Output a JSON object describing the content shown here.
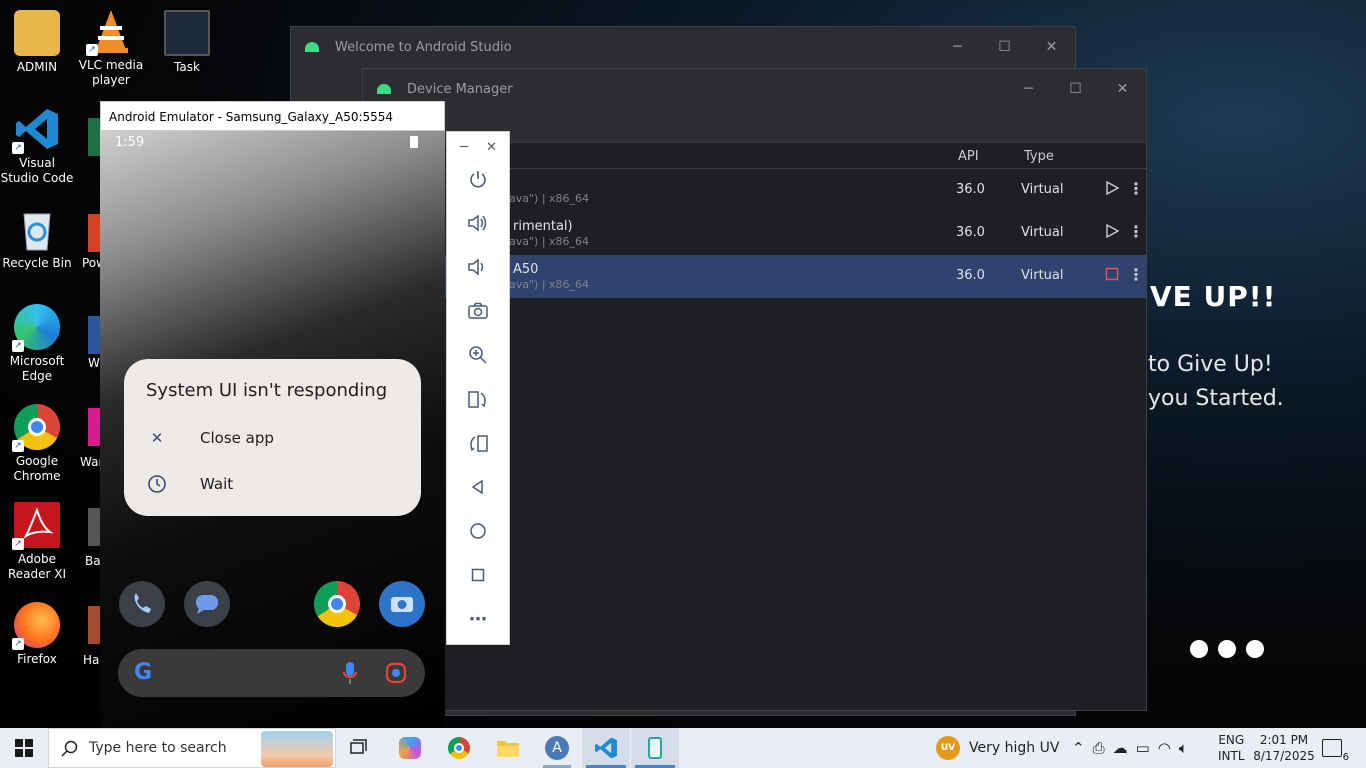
{
  "desktop": {
    "icons": [
      {
        "label": "ADMIN"
      },
      {
        "label": "VLC media player"
      },
      {
        "label": "Task"
      },
      {
        "label": "Visual Studio Code"
      },
      {
        "label": "Recycle Bin"
      },
      {
        "label": "Microsoft Edge"
      },
      {
        "label": "Google Chrome"
      },
      {
        "label": "Adobe Reader XI"
      },
      {
        "label": "Firefox"
      }
    ],
    "partial_labels": [
      "Pow",
      "W",
      "War",
      "Ba",
      "Ha"
    ],
    "wallpaper": {
      "headline": "VE UP!!",
      "line1": "to Give Up!",
      "line2": "you Started."
    }
  },
  "welcome_window": {
    "title": "Welcome to Android Studio"
  },
  "device_manager": {
    "title": "Device Manager",
    "columns": {
      "api": "API",
      "type": "Type"
    },
    "rows": [
      {
        "name": "",
        "sub": "ava\") | x86_64",
        "api": "36.0",
        "type": "Virtual",
        "running": false
      },
      {
        "name": "rimental)",
        "sub": "ava\") | x86_64",
        "api": "36.0",
        "type": "Virtual",
        "running": false
      },
      {
        "name": "A50",
        "sub": "ava\") | x86_64",
        "api": "36.0",
        "type": "Virtual",
        "running": true
      }
    ]
  },
  "emulator": {
    "title": "Android Emulator - Samsung_Galaxy_A50:5554",
    "status_time": "1:59",
    "dialog": {
      "title": "System UI isn't responding",
      "close_label": "Close app",
      "wait_label": "Wait"
    },
    "toolbar_icons": [
      "power-icon",
      "volume-up-icon",
      "volume-down-icon",
      "camera-icon",
      "zoom-icon",
      "rotate-left-icon",
      "rotate-right-icon",
      "back-icon",
      "home-icon",
      "overview-icon",
      "more-icon"
    ]
  },
  "taskbar": {
    "search_placeholder": "Type here to search",
    "weather": "Very high UV",
    "weather_badge": "UV",
    "language_top": "ENG",
    "language_bottom": "INTL",
    "time": "2:01 PM",
    "date": "8/17/2025",
    "notification_count": "6"
  }
}
